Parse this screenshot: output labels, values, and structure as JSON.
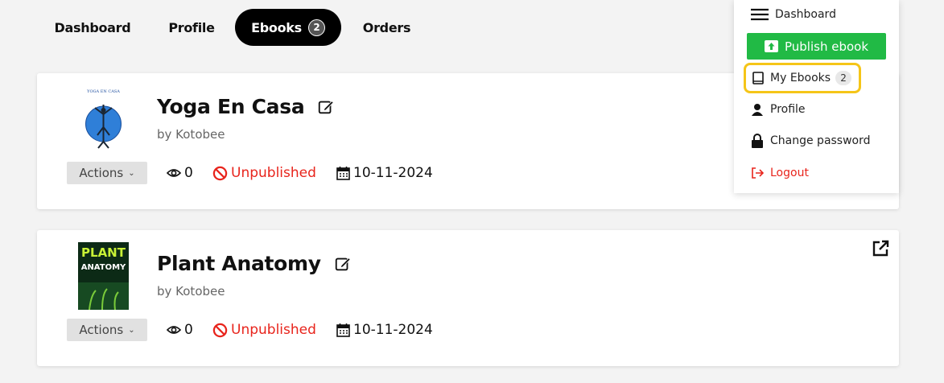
{
  "tabs": {
    "dashboard": "Dashboard",
    "profile": "Profile",
    "ebooks": "Ebooks",
    "ebooks_count": "2",
    "orders": "Orders"
  },
  "menu": {
    "dashboard": "Dashboard",
    "publish": "Publish ebook",
    "my_ebooks": "My Ebooks",
    "my_ebooks_count": "2",
    "profile": "Profile",
    "change_password": "Change password",
    "logout": "Logout"
  },
  "books": [
    {
      "title": "Yoga En Casa",
      "author": "by Kotobee",
      "actions": "Actions",
      "views": "0",
      "status": "Unpublished",
      "date": "10-11-2024",
      "cover_text": "YOGA EN CASA"
    },
    {
      "title": "Plant Anatomy",
      "author": "by Kotobee",
      "actions": "Actions",
      "views": "0",
      "status": "Unpublished",
      "date": "10-11-2024",
      "cover_text_1": "PLANT",
      "cover_text_2": "ANATOMY"
    }
  ],
  "colors": {
    "status_red": "#e8241c",
    "publish_green": "#21ba45",
    "highlight_yellow": "#f5c518",
    "active_tab": "#000000"
  }
}
